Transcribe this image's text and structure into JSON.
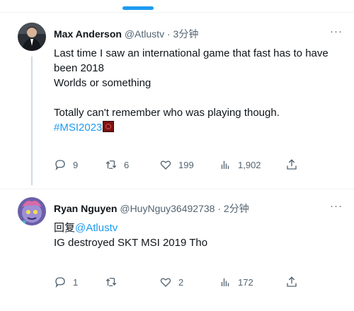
{
  "colors": {
    "accent": "#1d9bf0",
    "text_primary": "#0f1419",
    "text_secondary": "#536471",
    "divider": "#eff3f4"
  },
  "tweets": [
    {
      "author_name": "Max Anderson",
      "handle": "@Atlustv",
      "separator": "·",
      "time": "3分钟",
      "more_label": "···",
      "lines": [
        "Last time I saw an international game that fast has to have been 2018",
        "Worlds or something",
        "",
        "Totally can't remember who was playing though."
      ],
      "hashtag": "#MSI2023",
      "stats": {
        "replies": "9",
        "retweets": "6",
        "likes": "199",
        "views": "1,902"
      }
    },
    {
      "author_name": "Ryan Nguyen",
      "handle": "@HuyNguy36492738",
      "separator": "·",
      "time": "2分钟",
      "more_label": "···",
      "reply_prefix": "回复",
      "reply_to": "@Atlustv",
      "text": "IG destroyed SKT MSI 2019 Tho",
      "stats": {
        "replies": "1",
        "retweets": "",
        "likes": "2",
        "views": "172"
      }
    }
  ],
  "icons": [
    "reply-icon",
    "retweet-icon",
    "like-icon",
    "views-icon",
    "share-icon",
    "more-icon"
  ]
}
